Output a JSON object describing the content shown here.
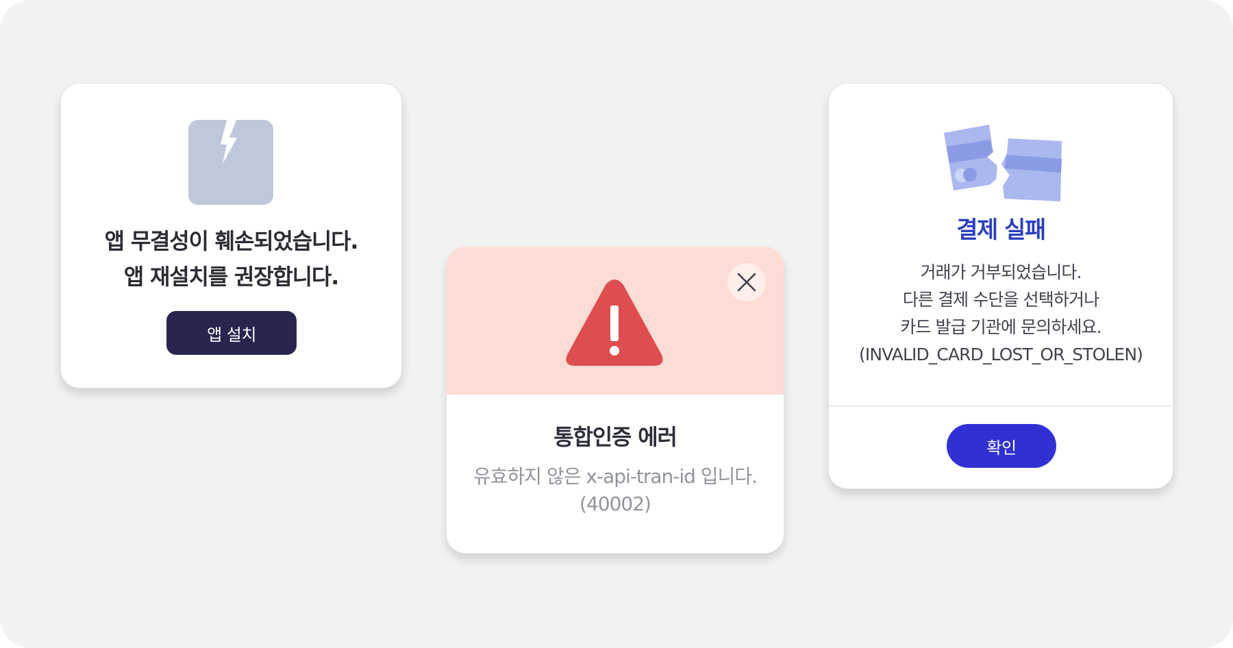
{
  "integrity_card": {
    "icon": "broken-app-icon",
    "message_lines": [
      "앱 무결성이 훼손되었습니다.",
      "앱 재설치를 권장합니다."
    ],
    "button_label": "앱 설치"
  },
  "auth_error_card": {
    "icon": "warning-triangle-icon",
    "close_icon": "close-icon",
    "title": "통합인증 에러",
    "description_lines": [
      "유효하지 않은 x-api-tran-id 입니다.",
      "(40002)"
    ]
  },
  "payment_fail_card": {
    "icon": "broken-card-icon",
    "title": "결제 실패",
    "description_lines": [
      "거래가 거부되었습니다.",
      "다른 결제 수단을 선택하거나",
      "카드 발급 기관에 문의하세요.",
      "(INVALID_CARD_LOST_OR_STOLEN)"
    ],
    "button_label": "확인"
  },
  "colors": {
    "background": "#f2f2f2",
    "dark_button": "#27264f",
    "error_header": "#fddcd5",
    "warning_red": "#de4d4f",
    "accent_blue": "#2c3fbf",
    "confirm_button": "#3131d3"
  }
}
